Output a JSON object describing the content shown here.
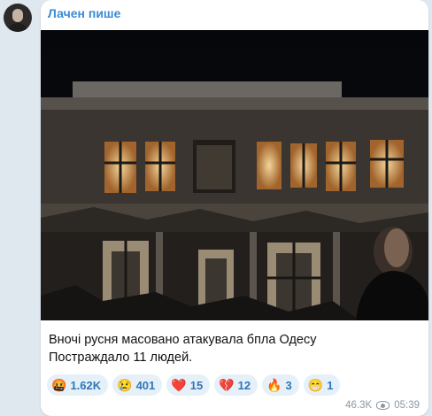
{
  "channel": {
    "author": "Лачен пише"
  },
  "post": {
    "caption": "Вночі русня масовано атакувала бпла Одесу\nПостраждало 11 людей.",
    "reactions": [
      {
        "emoji": "🤬",
        "count": "1.62K"
      },
      {
        "emoji": "😢",
        "count": "401"
      },
      {
        "emoji": "❤️",
        "count": "15"
      },
      {
        "emoji": "💔",
        "count": "12"
      },
      {
        "emoji": "🔥",
        "count": "3"
      },
      {
        "emoji": "😁",
        "count": "1"
      }
    ],
    "views": "46.3K",
    "time": "05:39"
  },
  "icons": {
    "views": "eye-icon"
  },
  "colors": {
    "author": "#3a8bd4",
    "reaction_bg": "#e6f0f8",
    "reaction_text": "#2d77b9",
    "background": "#dfe8ef"
  }
}
